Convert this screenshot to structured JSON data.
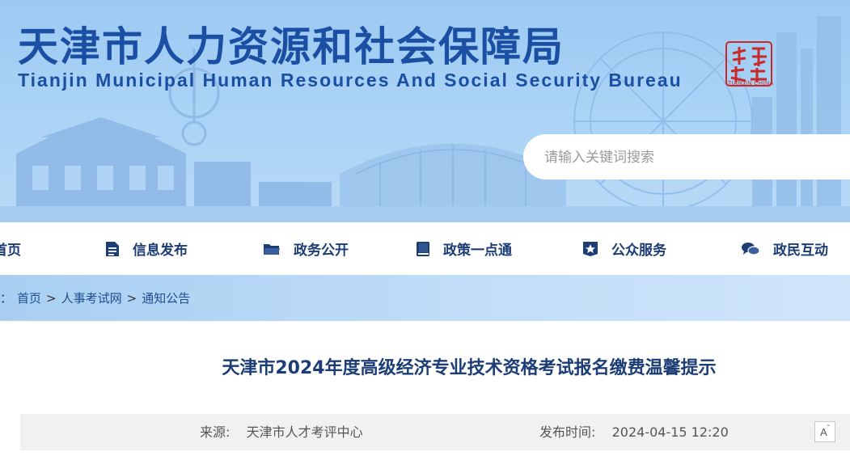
{
  "header": {
    "title_cn": "天津市人力资源和社会保障局",
    "title_en": "Tianjin Municipal Human Resources And Social Security Bureau",
    "seal_text": "TIANJIN CHINA",
    "brand_color": "#1b4fa3"
  },
  "search": {
    "placeholder": "请输入关键词搜索"
  },
  "nav": {
    "items": [
      {
        "label": "首页",
        "icon": "home-icon"
      },
      {
        "label": "信息发布",
        "icon": "document-icon"
      },
      {
        "label": "政务公开",
        "icon": "folder-icon"
      },
      {
        "label": "政策一点通",
        "icon": "book-icon"
      },
      {
        "label": "公众服务",
        "icon": "star-badge-icon"
      },
      {
        "label": "政民互动",
        "icon": "chat-icon"
      }
    ]
  },
  "breadcrumb": {
    "prefix": "：",
    "items": [
      "首页",
      "人事考试网",
      "通知公告"
    ],
    "separator": ">"
  },
  "article": {
    "title": "天津市2024年度高级经济专业技术资格考试报名缴费温馨提示",
    "source_label": "来源:",
    "source_value": "天津市人才考评中心",
    "time_label": "发布时间:",
    "time_value": "2024-04-15 12:20",
    "font_size_button": "A"
  }
}
